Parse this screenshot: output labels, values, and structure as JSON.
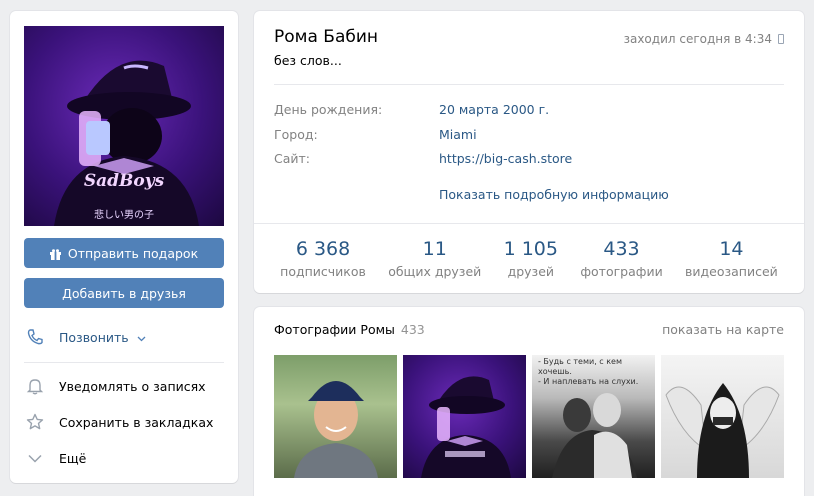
{
  "left_column": {
    "avatar": {
      "caption": "SadBoys",
      "subcaption": "悲しい男の子"
    },
    "gift_button": "Отправить подарок",
    "add_friend_button": "Добавить в друзья",
    "call": "Позвонить",
    "notify": "Уведомлять о записях",
    "bookmark": "Сохранить в закладках",
    "more": "Ещё"
  },
  "profile": {
    "name": "Рома Бабин",
    "status": "без слов...",
    "online": "заходил сегодня в 4:34",
    "info": [
      {
        "label": "День рождения:",
        "value": "20 марта 2000 г."
      },
      {
        "label": "Город:",
        "value": "Miami"
      },
      {
        "label": "Сайт:",
        "value": "https://big-cash.store"
      }
    ],
    "show_more": "Показать подробную информацию",
    "counters": [
      {
        "num": "6 368",
        "label": "подписчиков"
      },
      {
        "num": "11",
        "label": "общих друзей"
      },
      {
        "num": "1 105",
        "label": "друзей"
      },
      {
        "num": "433",
        "label": "фотографии"
      },
      {
        "num": "14",
        "label": "видеозаписей"
      }
    ]
  },
  "photos": {
    "title": "Фотографии Ромы",
    "count": "433",
    "show_on_map": "показать на карте",
    "thumb3_caption": [
      "- Будь с теми, с кем хочешь.",
      "- И наплевать на слухи."
    ]
  },
  "colors": {
    "accent": "#5181b8",
    "link": "#2a5885",
    "muted": "#828282",
    "bg": "#edeef0"
  }
}
